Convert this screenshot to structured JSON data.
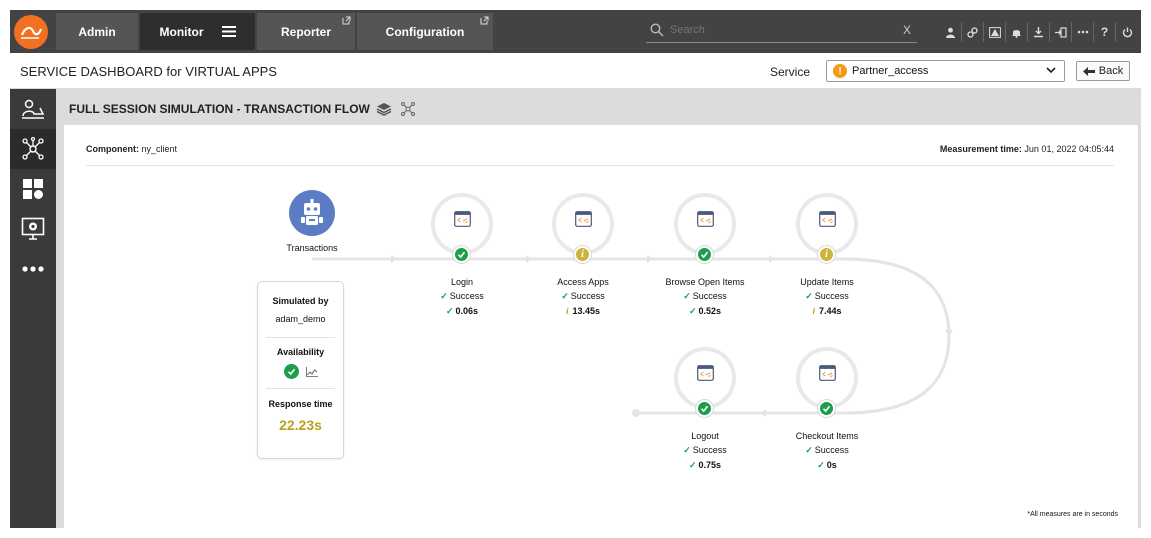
{
  "topbar": {
    "nav": [
      {
        "label": "Admin"
      },
      {
        "label": "Monitor"
      },
      {
        "label": "Reporter"
      },
      {
        "label": "Configuration"
      }
    ],
    "search_placeholder": "Search",
    "search_clear": "X"
  },
  "header": {
    "title": "SERVICE DASHBOARD for VIRTUAL APPS",
    "service_label": "Service",
    "service_value": "Partner_access",
    "service_warn": "!",
    "back_label": "Back"
  },
  "content": {
    "title": "FULL SESSION SIMULATION - TRANSACTION FLOW",
    "component_label": "Component:",
    "component_value": "ny_client",
    "measurement_label": "Measurement time:",
    "measurement_value": "Jun 01, 2022 04:05:44",
    "transactions_label": "Transactions",
    "summary": {
      "simulated_by_label": "Simulated by",
      "simulated_by_value": "adam_demo",
      "availability_label": "Availability",
      "response_time_label": "Response time",
      "response_time_value": "22.23s"
    },
    "steps": [
      {
        "name": "Login",
        "status": "Success",
        "time": "0.06s",
        "state": "ok"
      },
      {
        "name": "Access Apps",
        "status": "Success",
        "time": "13.45s",
        "state": "info"
      },
      {
        "name": "Browse Open Items",
        "status": "Success",
        "time": "0.52s",
        "state": "ok"
      },
      {
        "name": "Update Items",
        "status": "Success",
        "time": "7.44s",
        "state": "info"
      },
      {
        "name": "Checkout Items",
        "status": "Success",
        "time": "0s",
        "state": "ok"
      },
      {
        "name": "Logout",
        "status": "Success",
        "time": "0.75s",
        "state": "ok"
      }
    ],
    "footnote": "*All measures are in seconds"
  },
  "colors": {
    "accent_orange": "#f37021",
    "success_green": "#1e9e4a",
    "info_yellow": "#c9b53a",
    "robot_blue": "#5c7dc6"
  }
}
